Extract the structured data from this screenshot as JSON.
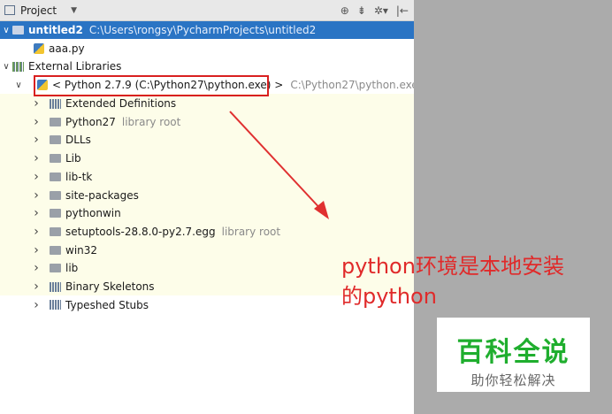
{
  "toolbar": {
    "title": "Project",
    "caret": "▼",
    "icons": [
      "target-icon",
      "collapse-icon",
      "gear-icon",
      "hide-icon"
    ],
    "icon_glyphs": {
      "target": "⊕",
      "collapse": "⇟",
      "gear": "✲▾",
      "hide": "|←"
    }
  },
  "tree": {
    "project": {
      "name": "untitled2",
      "path": "C:\\Users\\rongsy\\PycharmProjects\\untitled2"
    },
    "file": {
      "name": "aaa.py"
    },
    "external": {
      "label": "External Libraries"
    },
    "sdk": {
      "label": "< Python 2.7.9 (C:\\Python27\\python.exe) >",
      "path": "C:\\Python27\\python.exe"
    },
    "items": [
      {
        "label": "Extended Definitions",
        "hint": "",
        "icon": "library"
      },
      {
        "label": "Python27",
        "hint": "library root",
        "icon": "folder"
      },
      {
        "label": "DLLs",
        "hint": "",
        "icon": "folder"
      },
      {
        "label": "Lib",
        "hint": "",
        "icon": "folder"
      },
      {
        "label": "lib-tk",
        "hint": "",
        "icon": "folder"
      },
      {
        "label": "site-packages",
        "hint": "",
        "icon": "folder"
      },
      {
        "label": "pythonwin",
        "hint": "",
        "icon": "folder"
      },
      {
        "label": "setuptools-28.8.0-py2.7.egg",
        "hint": "library root",
        "icon": "folder"
      },
      {
        "label": "win32",
        "hint": "",
        "icon": "folder"
      },
      {
        "label": "lib",
        "hint": "",
        "icon": "folder"
      },
      {
        "label": "Binary Skeletons",
        "hint": "",
        "icon": "library"
      },
      {
        "label": "Typeshed Stubs",
        "hint": "",
        "icon": "library"
      }
    ]
  },
  "annotation": {
    "line1": "python环境是本地安装",
    "line2": "的python"
  },
  "watermark": {
    "title": "百科全说",
    "subtitle": "助你轻松解决"
  },
  "colors": {
    "selection": "#2a74c4",
    "annotation": "#e02a2a",
    "watermark": "#1fae2e"
  }
}
